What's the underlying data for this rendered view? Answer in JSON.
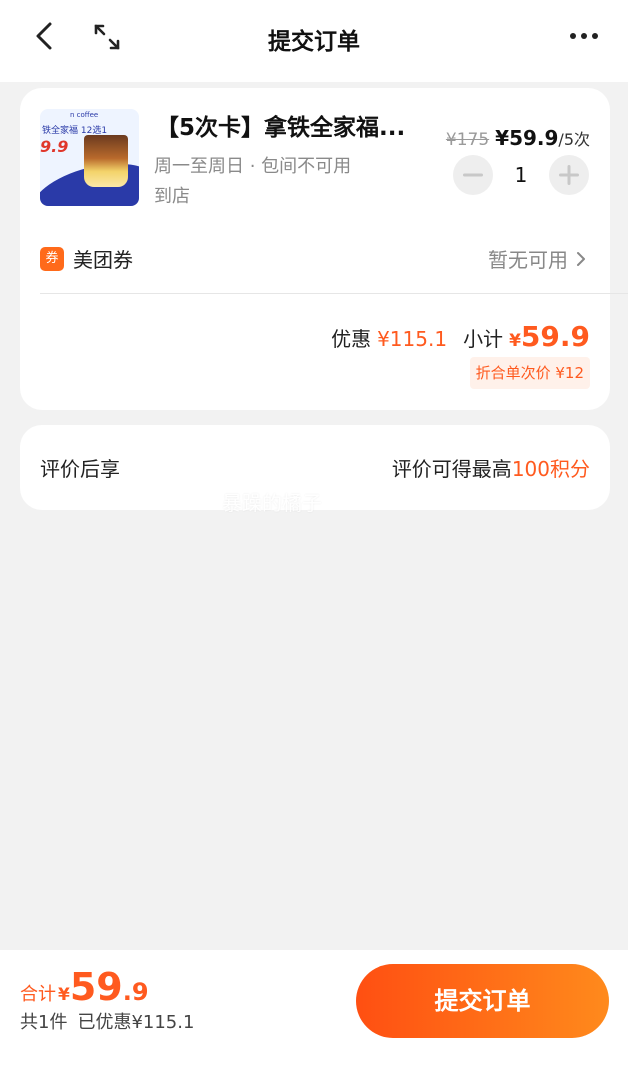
{
  "header": {
    "title": "提交订单",
    "back_icon": "chevron-left-icon",
    "expand_icon": "expand-icon",
    "more_icon": "more-dots-icon"
  },
  "product": {
    "title": "【5次卡】拿铁全家福...",
    "subtitle_line1": "周一至周日 · 包间不可用",
    "subtitle_line2": "到店",
    "price_original": "¥175",
    "price_current": "¥59.9",
    "price_unit": "/5次",
    "quantity": "1",
    "thumb_text_top": "n coffee",
    "thumb_text_mid": "铁全家福 12选1",
    "thumb_text_price": "9.9"
  },
  "coupon": {
    "badge": "券",
    "label": "美团券",
    "value": "暂无可用"
  },
  "summary": {
    "discount_label": "优惠",
    "discount_value": "¥115.1",
    "subtotal_label": "小计",
    "subtotal_currency": "¥",
    "subtotal_value": "59.9",
    "per_use_text": "折合单次价 ¥12"
  },
  "review": {
    "left": "评价后享",
    "right_prefix": "评价可得最高",
    "right_highlight": "100积分"
  },
  "watermark": "暴躁的橘子",
  "footer": {
    "total_label": "合计",
    "total_currency": "¥",
    "total_int": "59",
    "total_dec": ".9",
    "count": "共1件",
    "saved": "已优惠¥115.1",
    "submit_label": "提交订单"
  },
  "colors": {
    "accent": "#ff5a1f",
    "submit_gradient_start": "#ff4f12",
    "submit_gradient_end": "#ff8a1c"
  }
}
